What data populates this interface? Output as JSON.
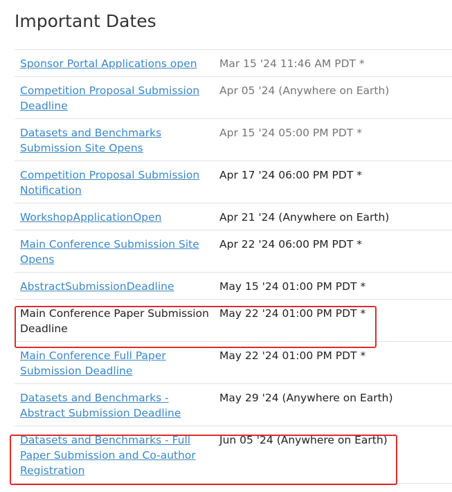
{
  "page": {
    "title": "Important Dates"
  },
  "dates": [
    {
      "name": "Sponsor Portal Applications open",
      "date": "Mar 15 '24 11:46 AM PDT *",
      "link": true,
      "date_style": "gray"
    },
    {
      "name": "Competition Proposal Submission Deadline",
      "date": "Apr 05 '24 (Anywhere on Earth)",
      "link": true,
      "date_style": "gray"
    },
    {
      "name": "Datasets and Benchmarks Submission Site Opens",
      "date": "Apr 15 '24 05:00 PM PDT *",
      "link": true,
      "date_style": "gray"
    },
    {
      "name": "Competition Proposal Submission Notification",
      "date": "Apr 17 '24 06:00 PM PDT *",
      "link": true,
      "date_style": "dark"
    },
    {
      "name": "WorkshopApplicationOpen",
      "date": "Apr 21 '24 (Anywhere on Earth)",
      "link": true,
      "date_style": "dark"
    },
    {
      "name": "Main Conference Submission Site Opens",
      "date": "Apr 22 '24 06:00 PM PDT *",
      "link": true,
      "date_style": "dark"
    },
    {
      "name": "AbstractSubmissionDeadline",
      "date": "May 15 '24 01:00 PM PDT *",
      "link": true,
      "date_style": "dark"
    },
    {
      "name": "Main Conference Paper Submission Deadline",
      "date": "May 22 '24 01:00 PM PDT *",
      "link": false,
      "date_style": "dark"
    },
    {
      "name": "Main Conference Full Paper Submission Deadline",
      "date": "May 22 '24 01:00 PM PDT *",
      "link": true,
      "date_style": "dark"
    },
    {
      "name": "Datasets and Benchmarks - Abstract Submission Deadline",
      "date": "May 29 '24 (Anywhere on Earth)",
      "link": true,
      "date_style": "dark"
    },
    {
      "name": "Datasets and Benchmarks - Full Paper Submission and Co-author Registration",
      "date": "Jun 05 '24 (Anywhere on Earth)",
      "link": true,
      "date_style": "dark"
    }
  ],
  "colors": {
    "link": "#3a87c8",
    "highlight_box": "#e02a2a",
    "date_gray": "#757575",
    "date_dark": "#222222"
  }
}
